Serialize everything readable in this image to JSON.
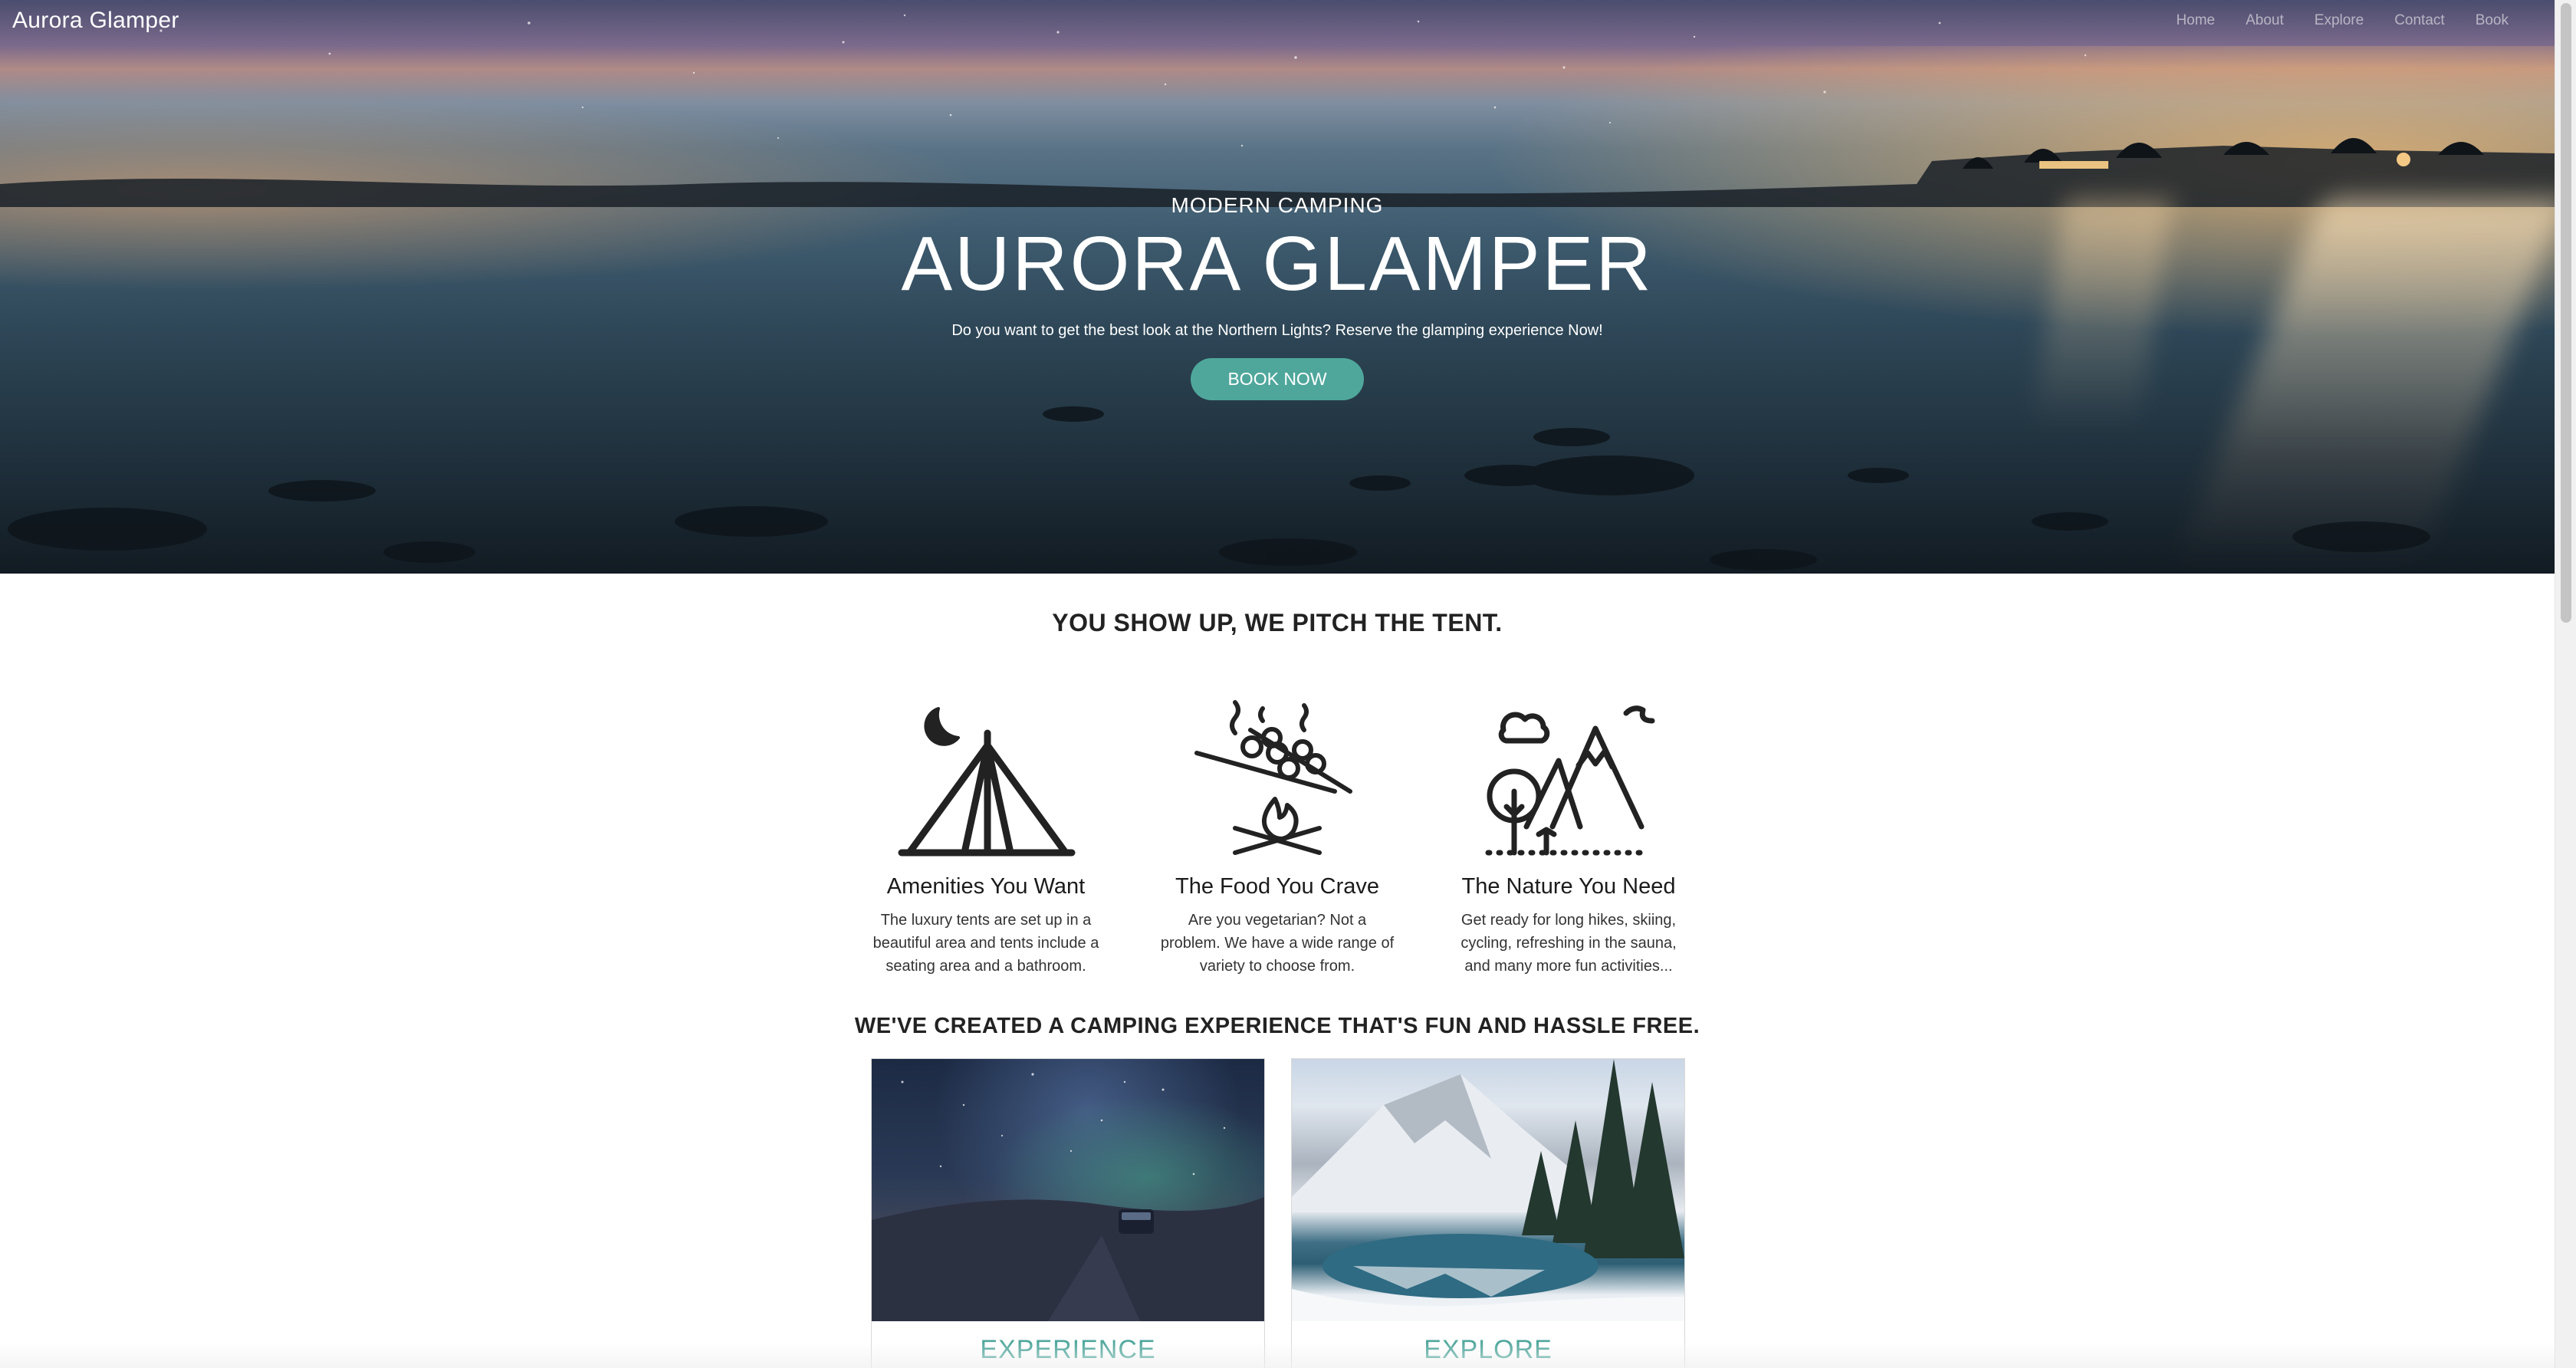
{
  "nav": {
    "brand": "Aurora Glamper",
    "links": [
      "Home",
      "About",
      "Explore",
      "Contact",
      "Book"
    ]
  },
  "hero": {
    "eyebrow": "MODERN CAMPING",
    "title": "AURORA GLAMPER",
    "subtitle": "Do you want to get the best look at the Northern Lights? Reserve the glamping experience Now!",
    "cta": "BOOK NOW"
  },
  "section1": {
    "heading": "YOU SHOW UP, WE PITCH THE TENT.",
    "features": [
      {
        "icon": "tent-moon-icon",
        "title": "Amenities You Want",
        "text": "The luxury tents are set up in a beautiful area and tents include a seating area and a bathroom."
      },
      {
        "icon": "campfire-marshmallow-icon",
        "title": "The Food You Crave",
        "text": "Are you vegetarian? Not a problem. We have a wide range of variety to choose from."
      },
      {
        "icon": "mountain-tree-icon",
        "title": "The Nature You Need",
        "text": "Get ready for long hikes, skiing, cycling, refreshing in the sauna, and many more fun activities..."
      }
    ]
  },
  "section2": {
    "heading": "WE'VE CREATED A CAMPING EXPERIENCE THAT'S FUN AND HASSLE FREE.",
    "cards": [
      {
        "caption": "EXPERIENCE",
        "image": "night-sky-car-photo"
      },
      {
        "caption": "EXPLORE",
        "image": "snowy-mountain-lake-photo"
      }
    ]
  },
  "colors": {
    "accent": "#4fa79c",
    "text": "#222222",
    "nav_link": "#ffffff8c"
  }
}
